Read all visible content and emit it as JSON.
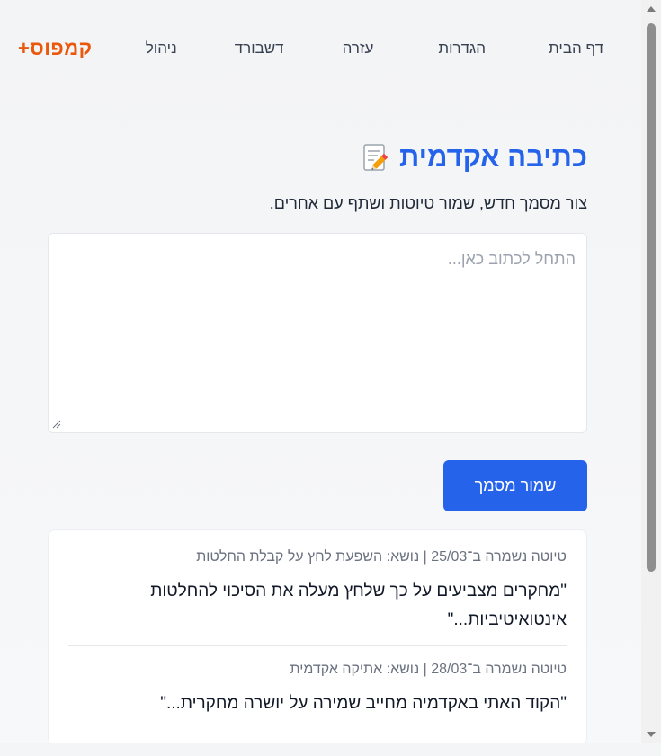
{
  "nav": {
    "home": "דף הבית",
    "settings": "הגדרות",
    "help": "עזרה",
    "dashboard": "דשבורד",
    "admin": "ניהול"
  },
  "logo": "קמפוס+",
  "page": {
    "title": "כתיבה אקדמית",
    "title_icon": "memo-icon",
    "subtitle": "צור מסמך חדש, שמור טיוטות ושתף עם אחרים."
  },
  "editor": {
    "placeholder": "התחל לכתוב כאן...",
    "value": ""
  },
  "save_button": "שמור מסמך",
  "drafts": [
    {
      "meta": "טיוטה נשמרה ב־25/03 | נושא: השפעת לחץ על קבלת החלטות",
      "text": "\"מחקרים מצביעים על כך שלחץ מעלה את הסיכוי להחלטות אינטואיטיביות...\""
    },
    {
      "meta": "טיוטה נשמרה ב־28/03 | נושא: אתיקה אקדמית",
      "text": "\"הקוד האתי באקדמיה מחייב שמירה על יושרה מחקרית...\""
    }
  ],
  "colors": {
    "accent": "#2563eb",
    "brand": "#ea580c",
    "background": "#f4f5f7"
  }
}
